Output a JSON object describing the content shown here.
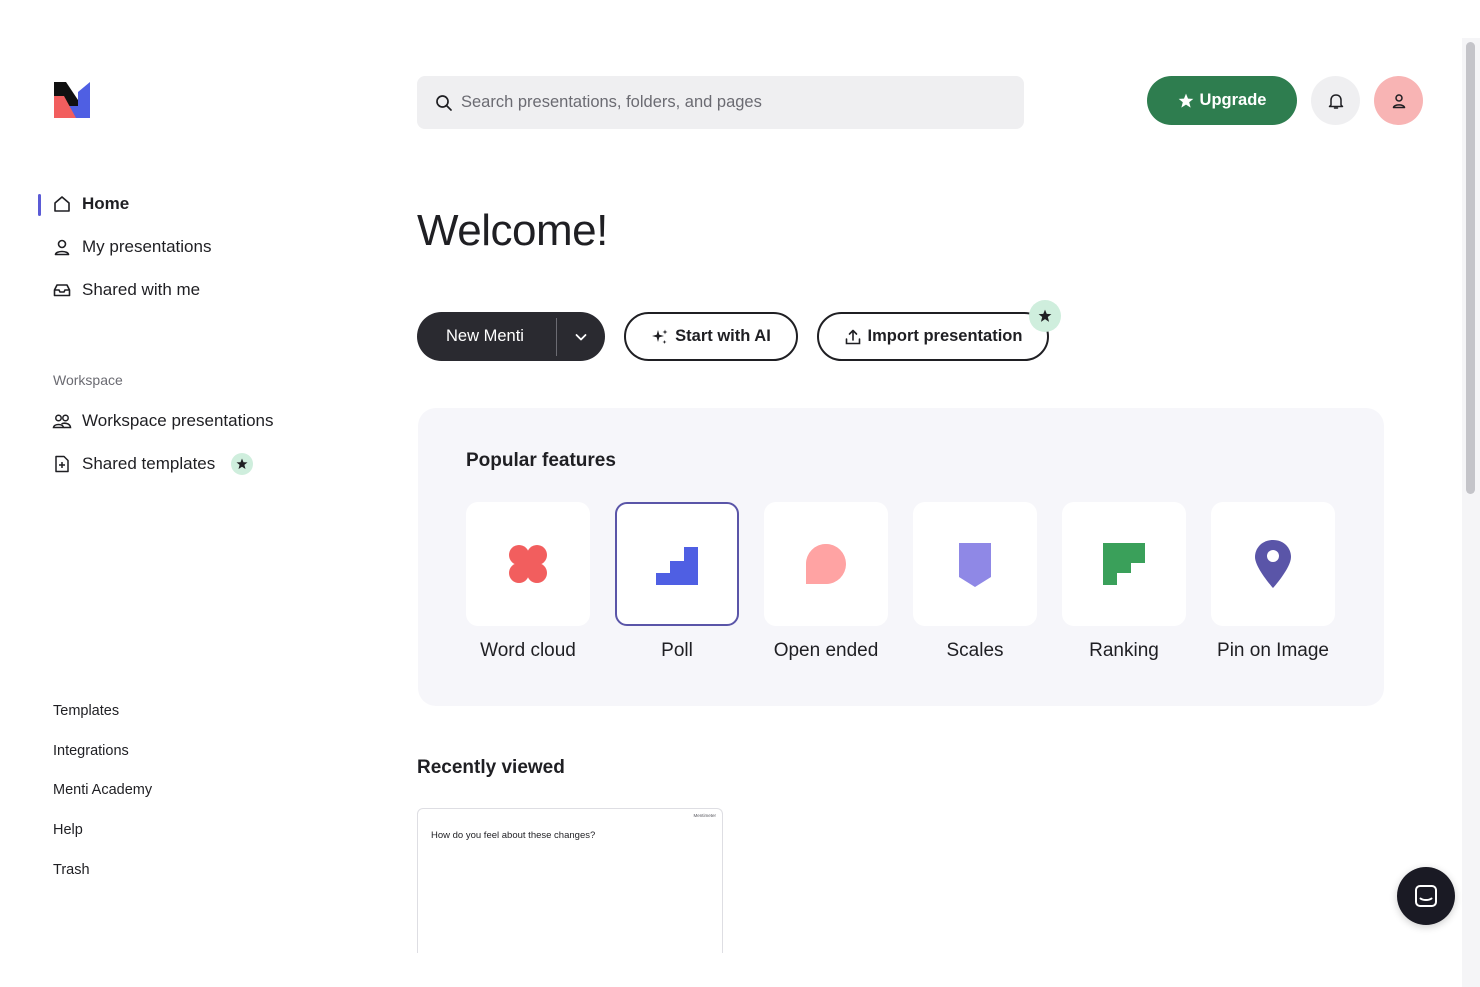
{
  "sidebar": {
    "logo_icon": "mentimeter-logo-icon",
    "items": [
      {
        "label": "Home",
        "icon": "home-icon",
        "active": true
      },
      {
        "label": "My presentations",
        "icon": "person-icon"
      },
      {
        "label": "Shared with me",
        "icon": "inbox-icon"
      }
    ],
    "workspace_label": "Workspace",
    "workspace_items": [
      {
        "label": "Workspace presentations",
        "icon": "people-icon"
      },
      {
        "label": "Shared templates",
        "icon": "template-add-icon",
        "badge": "star-icon"
      }
    ],
    "bottom_links": [
      "Templates",
      "Integrations",
      "Menti Academy",
      "Help",
      "Trash"
    ]
  },
  "header": {
    "search_placeholder": "Search presentations, folders, and pages",
    "upgrade_label": "Upgrade",
    "accent": "#2e7d4f"
  },
  "main": {
    "welcome": "Welcome!",
    "new_menti_label": "New Menti",
    "start_ai_label": "Start with AI",
    "import_label": "Import presentation",
    "features_title": "Popular features",
    "features": [
      {
        "label": "Word cloud",
        "icon": "word-cloud-icon",
        "color": "#f25e5e"
      },
      {
        "label": "Poll",
        "icon": "poll-icon",
        "color": "#4f5fe3",
        "selected": true
      },
      {
        "label": "Open ended",
        "icon": "open-ended-icon",
        "color": "#ffa3a3"
      },
      {
        "label": "Scales",
        "icon": "scales-icon",
        "color": "#8f88e6"
      },
      {
        "label": "Ranking",
        "icon": "ranking-icon",
        "color": "#3aa05a"
      },
      {
        "label": "Pin on Image",
        "icon": "pin-icon",
        "color": "#5a55a8"
      }
    ],
    "recent_title": "Recently viewed",
    "recent_items": [
      {
        "question": "How do you feel about these changes?",
        "brand": "Mentimeter"
      }
    ]
  }
}
